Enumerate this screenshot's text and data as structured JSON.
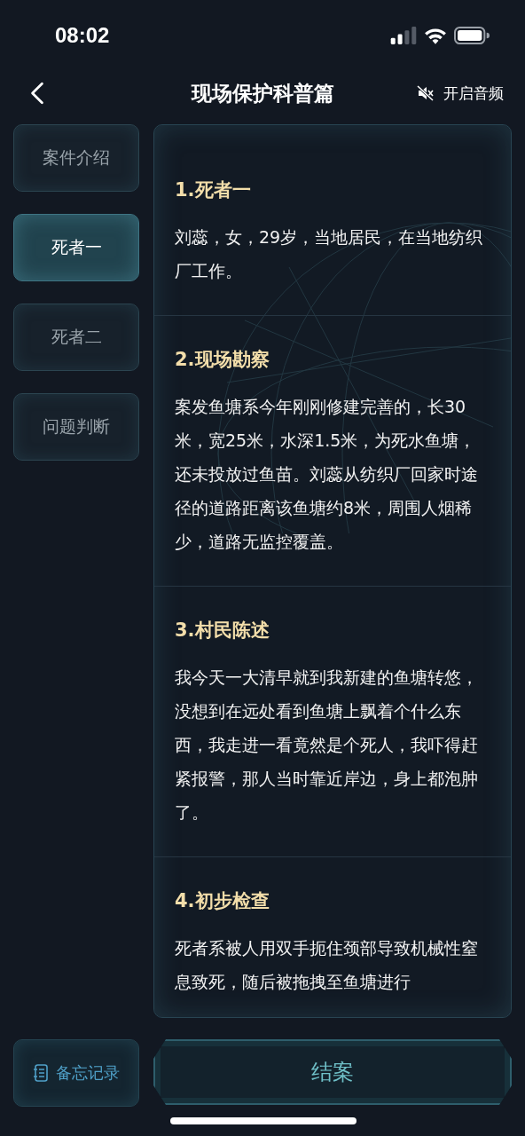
{
  "status_bar": {
    "time": "08:02"
  },
  "header": {
    "title": "现场保护科普篇",
    "audio_label": "开启音频"
  },
  "tabs": [
    {
      "label": "案件介绍",
      "selected": false
    },
    {
      "label": "死者一",
      "selected": true
    },
    {
      "label": "死者二",
      "selected": false
    },
    {
      "label": "问题判断",
      "selected": false
    }
  ],
  "sections": [
    {
      "title": "1.死者一",
      "body": "刘蕊，女，29岁，当地居民，在当地纺织厂工作。"
    },
    {
      "title": "2.现场勘察",
      "body": "案发鱼塘系今年刚刚修建完善的，长30米，宽25米，水深1.5米，为死水鱼塘，还未投放过鱼苗。刘蕊从纺织厂回家时途径的道路距离该鱼塘约8米，周围人烟稀少，道路无监控覆盖。"
    },
    {
      "title": "3.村民陈述",
      "body": "我今天一大清早就到我新建的鱼塘转悠，没想到在远处看到鱼塘上飘着个什么东西，我走进一看竟然是个死人，我吓得赶紧报警，那人当时靠近岸边，身上都泡肿了。"
    },
    {
      "title": "4.初步检查",
      "body": "死者系被人用双手扼住颈部导致机械性窒息致死，随后被拖拽至鱼塘进行"
    }
  ],
  "footer": {
    "memo_button": "备忘记录",
    "close_case_button": "结案"
  }
}
